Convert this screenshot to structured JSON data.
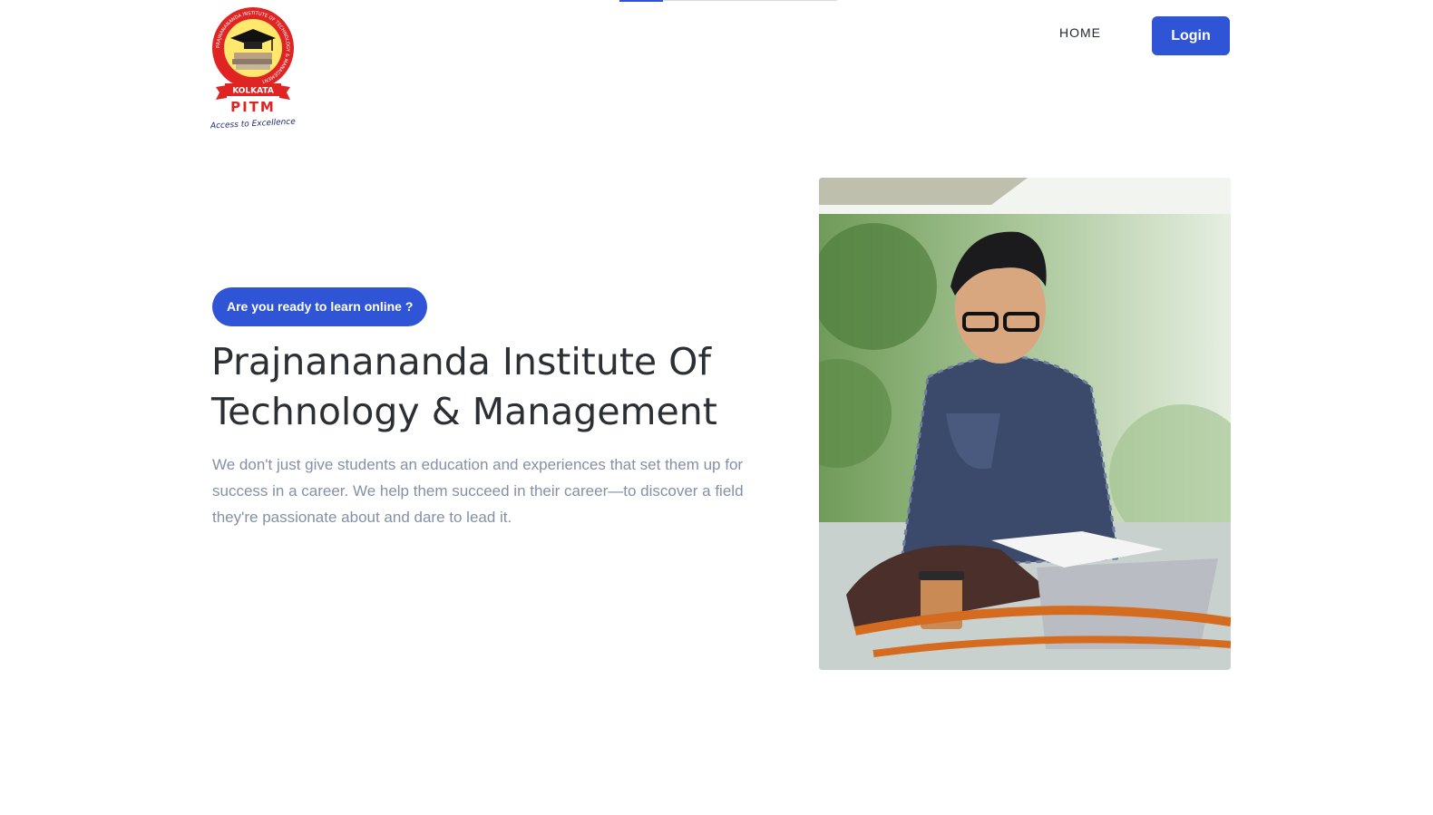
{
  "loading_bar": {
    "progress": 0.2
  },
  "logo": {
    "ring_text": "PRAJNANANANDA INSTITUTE OF TECHNOLOGY & MANAGEMENT",
    "city": "KOLKATA",
    "acronym": "PITM",
    "tagline": "Access to Excellence"
  },
  "nav": {
    "home_label": "HOME",
    "login_label": "Login"
  },
  "hero": {
    "badge": "Are you ready to learn online ?",
    "title_line1": "Prajnanananda Institute Of",
    "title_line2": "Technology & Management",
    "description": "We don't just give students an education and experiences that set them up for success in a career. We help them succeed in their career—to discover a field they're passionate about and dare to lead it."
  },
  "colors": {
    "accent": "#2f54d6",
    "title": "#2c2f33",
    "body_text": "#8490a3",
    "logo_red": "#e02424",
    "logo_yellow": "#ffe86b"
  }
}
